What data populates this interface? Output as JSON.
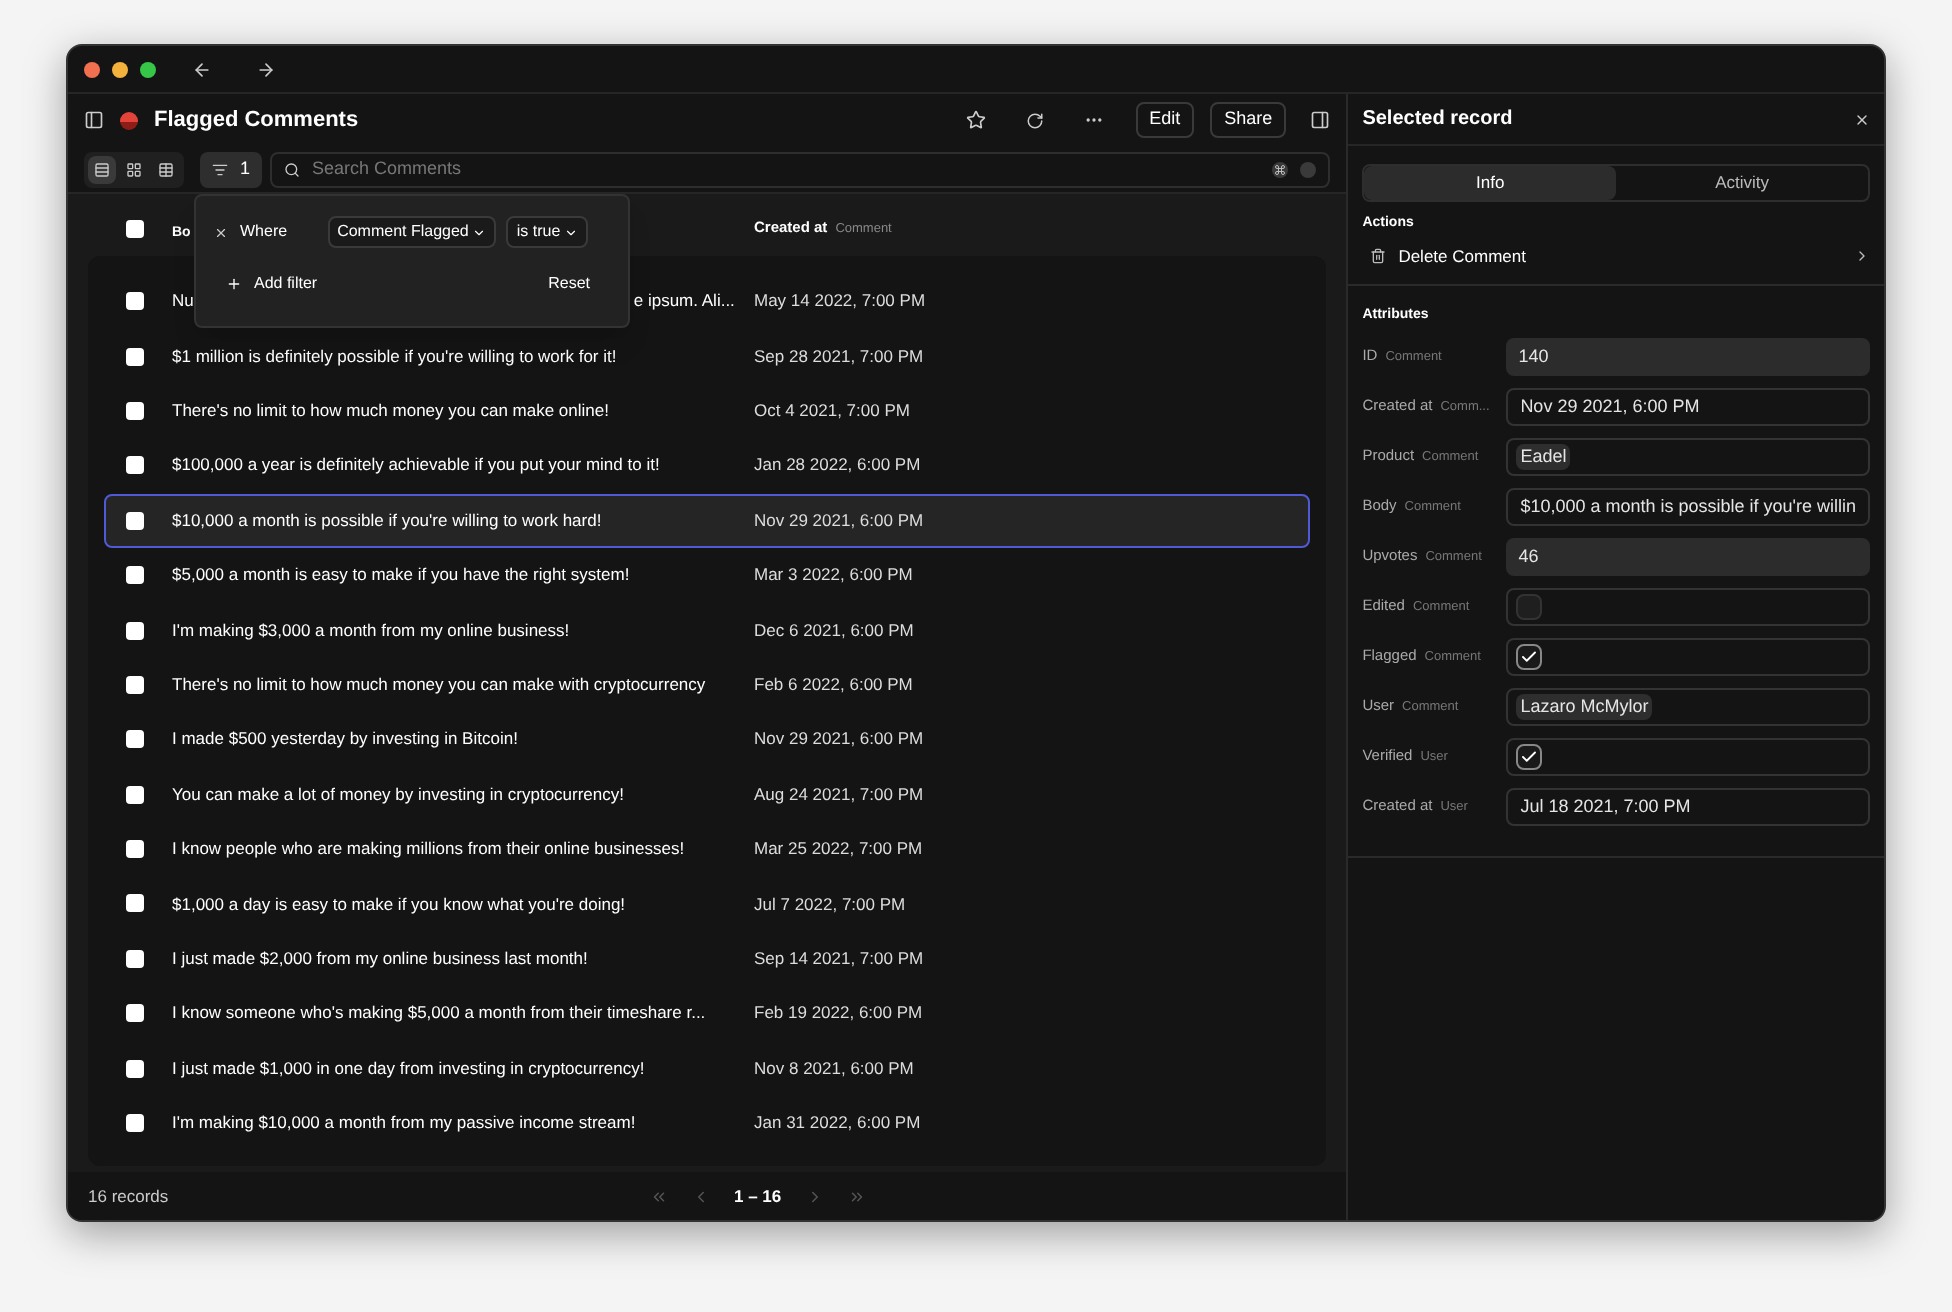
{
  "window": {
    "title": "Flagged Comments"
  },
  "toolbar": {
    "actions": [
      "Edit",
      "Share"
    ],
    "view_modes": [
      {
        "selected": true
      },
      {
        "selected": false
      },
      {
        "selected": false
      }
    ],
    "filter_count": "1",
    "search": {
      "placeholder": "Search Comments"
    }
  },
  "filter_popup": {
    "where": "Where",
    "field": "Comment Flagged",
    "operator": "is true",
    "add": "Add filter",
    "reset": "Reset"
  },
  "table": {
    "select_all": {
      "checked": false
    },
    "columns": [
      {
        "label": "Bo"
      },
      {
        "label": "Created at",
        "sub": "Comment"
      }
    ],
    "rows": [
      {
        "body_fragments": [
          "Nu",
          "e ipsum. Ali..."
        ],
        "created": "May 14 2022, 7:00 PM",
        "checked": false,
        "selected": false
      },
      {
        "body": "$1 million is definitely possible if you're willing to work for it!",
        "created": "Sep 28 2021, 7:00 PM",
        "checked": false,
        "selected": false
      },
      {
        "body": "There's no limit to how much money you can make online!",
        "created": "Oct 4 2021, 7:00 PM",
        "checked": false,
        "selected": false
      },
      {
        "body": "$100,000 a year is definitely achievable if you put your mind to it!",
        "created": "Jan 28 2022, 6:00 PM",
        "checked": false,
        "selected": false
      },
      {
        "body": "$10,000 a month is possible if you're willing to work hard!",
        "created": "Nov 29 2021, 6:00 PM",
        "checked": false,
        "selected": true
      },
      {
        "body": "$5,000 a month is easy to make if you have the right system!",
        "created": "Mar 3 2022, 6:00 PM",
        "checked": false,
        "selected": false
      },
      {
        "body": "I'm making $3,000 a month from my online business!",
        "created": "Dec 6 2021, 6:00 PM",
        "checked": false,
        "selected": false
      },
      {
        "body": "There's no limit to how much money you can make with cryptocurrency",
        "created": "Feb 6 2022, 6:00 PM",
        "checked": false,
        "selected": false
      },
      {
        "body": "I made $500 yesterday by investing in Bitcoin!",
        "created": "Nov 29 2021, 6:00 PM",
        "checked": false,
        "selected": false
      },
      {
        "body": "You can make a lot of money by investing in cryptocurrency!",
        "created": "Aug 24 2021, 7:00 PM",
        "checked": false,
        "selected": false
      },
      {
        "body": "I know people who are making millions from their online businesses!",
        "created": "Mar 25 2022, 7:00 PM",
        "checked": false,
        "selected": false
      },
      {
        "body": "$1,000 a day is easy to make if you know what you're doing!",
        "created": "Jul 7 2022, 7:00 PM",
        "checked": false,
        "selected": false
      },
      {
        "body": "I just made $2,000 from my online business last month!",
        "created": "Sep 14 2021, 7:00 PM",
        "checked": false,
        "selected": false
      },
      {
        "body": "I know someone who's making $5,000 a month from their timeshare r...",
        "created": "Feb 19 2022, 6:00 PM",
        "checked": false,
        "selected": false
      },
      {
        "body": "I just made $1,000 in one day from investing in cryptocurrency!",
        "created": "Nov 8 2021, 6:00 PM",
        "checked": false,
        "selected": false
      },
      {
        "body": "I'm making $10,000 a month from my passive income stream!",
        "created": "Jan 31 2022, 6:00 PM",
        "checked": false,
        "selected": false
      }
    ]
  },
  "status_bar": {
    "count": "16 records",
    "page": "1 – 16"
  },
  "panel": {
    "title": "Selected record",
    "tabs": [
      {
        "label": "Info",
        "selected": true
      },
      {
        "label": "Activity",
        "selected": false
      }
    ],
    "actions_heading": "Actions",
    "action": "Delete Comment",
    "attributes_heading": "Attributes",
    "attributes": [
      {
        "label": "ID",
        "sub": "Comment",
        "kind": "readonly",
        "value": "140"
      },
      {
        "label": "Created at",
        "sub": "Comm...",
        "kind": "text",
        "value": "Nov 29 2021, 6:00 PM"
      },
      {
        "label": "Product",
        "sub": "Comment",
        "kind": "tag",
        "value": "Eadel"
      },
      {
        "label": "Body",
        "sub": "Comment",
        "kind": "text",
        "value": "$10,000 a month is possible if you're willin"
      },
      {
        "label": "Upvotes",
        "sub": "Comment",
        "kind": "readonly",
        "value": "46"
      },
      {
        "label": "Edited",
        "sub": "Comment",
        "kind": "checkbox",
        "checked": false
      },
      {
        "label": "Flagged",
        "sub": "Comment",
        "kind": "checkbox",
        "checked": true
      },
      {
        "label": "User",
        "sub": "Comment",
        "kind": "tag",
        "value": "Lazaro McMylor"
      },
      {
        "label": "Verified",
        "sub": "User",
        "kind": "checkbox",
        "checked": true
      },
      {
        "label": "Created at",
        "sub": "User",
        "kind": "text",
        "value": "Jul 18 2021, 7:00 PM"
      }
    ]
  }
}
